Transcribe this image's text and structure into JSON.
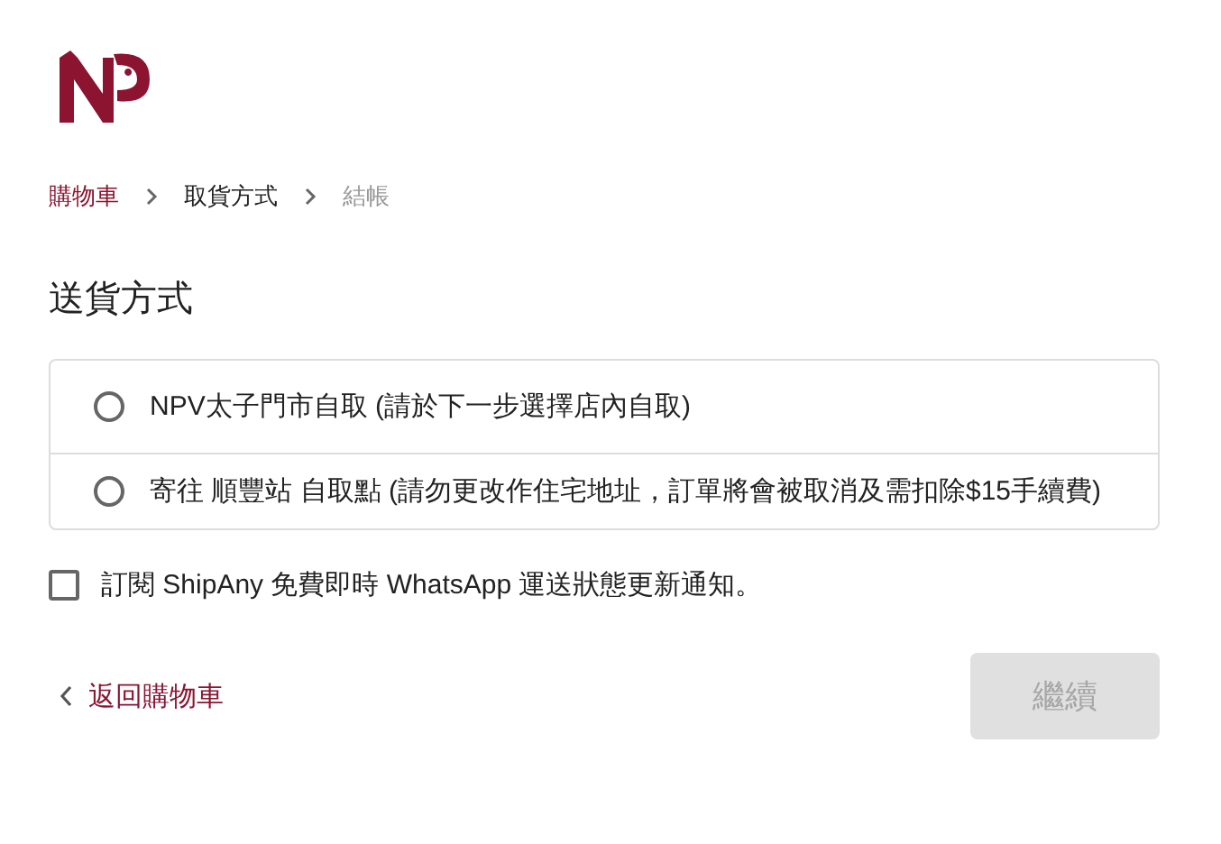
{
  "breadcrumb": [
    {
      "label": "購物車",
      "kind": "link"
    },
    {
      "label": "取貨方式",
      "kind": "current"
    },
    {
      "label": "結帳",
      "kind": "upcoming"
    }
  ],
  "heading": "送貨方式",
  "shipping_options": [
    {
      "label": "NPV太子門市自取 (請於下一步選擇店內自取)",
      "selected": false
    },
    {
      "label": "寄往 順豐站 自取點 (請勿更改作住宅地址，訂單將會被取消及需扣除$15手續費)",
      "selected": false
    }
  ],
  "subscribe": {
    "label": "訂閱 ShipAny 免費即時 WhatsApp 運送狀態更新通知。",
    "checked": false
  },
  "back_link": "返回購物車",
  "continue_button": {
    "label": "繼續",
    "disabled": true
  }
}
